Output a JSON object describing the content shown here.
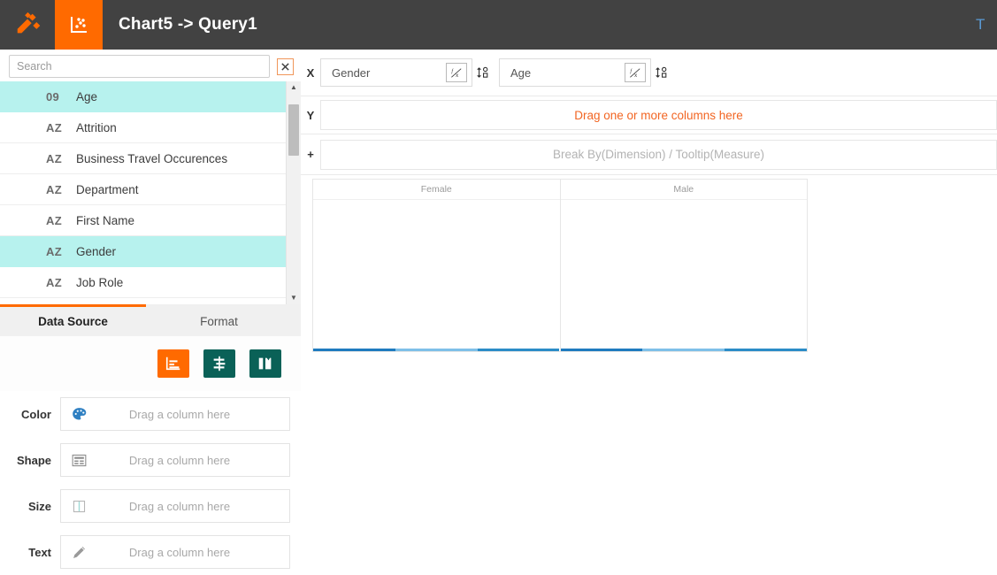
{
  "header": {
    "title": "Chart5 -> Query1",
    "logo_icon": "app-logo-icon",
    "chart_tab_icon": "scatter-chart-icon",
    "right_edge_label": "T"
  },
  "sidebar": {
    "search": {
      "placeholder": "Search",
      "value": "",
      "clear_label": "✕"
    },
    "columns": [
      {
        "type": "09",
        "name": "Age",
        "selected": true
      },
      {
        "type": "AZ",
        "name": "Attrition",
        "selected": false
      },
      {
        "type": "AZ",
        "name": "Business Travel Occurences",
        "selected": false
      },
      {
        "type": "AZ",
        "name": "Department",
        "selected": false
      },
      {
        "type": "AZ",
        "name": "First Name",
        "selected": false
      },
      {
        "type": "AZ",
        "name": "Gender",
        "selected": true
      },
      {
        "type": "AZ",
        "name": "Job Role",
        "selected": false
      }
    ],
    "scrollbar": {
      "up": "▲",
      "down": "▼"
    },
    "tabs": [
      {
        "label": "Data Source",
        "active": true
      },
      {
        "label": "Format",
        "active": false
      }
    ],
    "chart_type_buttons": [
      {
        "name": "bar-chart-type-button",
        "color": "#ff6a00",
        "active": true
      },
      {
        "name": "stacked-chart-type-button",
        "color": "#0a6157",
        "active": false
      },
      {
        "name": "rotate-chart-type-button",
        "color": "#0a6157",
        "active": false
      }
    ],
    "encodings": [
      {
        "label": "Color",
        "icon": "palette-icon",
        "placeholder": "Drag a column here"
      },
      {
        "label": "Shape",
        "icon": "shape-form-icon",
        "placeholder": "Drag a column here"
      },
      {
        "label": "Size",
        "icon": "size-bar-icon",
        "placeholder": "Drag a column here"
      },
      {
        "label": "Text",
        "icon": "pencil-icon",
        "placeholder": "Drag a column here"
      }
    ]
  },
  "shelves": {
    "x": {
      "key": "X",
      "pills": [
        {
          "text": "Gender",
          "fx_icon": "function-fx-icon",
          "sort_icon": "sort-az-icon"
        },
        {
          "text": "Age",
          "fx_icon": "function-fx-icon",
          "sort_icon": "sort-az-icon"
        }
      ]
    },
    "y": {
      "key": "Y",
      "placeholder": "Drag one or more columns here"
    },
    "plus": {
      "key": "+",
      "placeholder": "Break By(Dimension) / Tooltip(Measure)"
    }
  },
  "chart_data": {
    "type": "bar",
    "title": "",
    "xlabel": "",
    "ylabel": "",
    "facet_field": "Gender",
    "categories": [
      "Female",
      "Male"
    ],
    "series": [
      {
        "name": "Female",
        "values": [
          0,
          0,
          0
        ]
      },
      {
        "name": "Male",
        "values": [
          0,
          0,
          0
        ]
      }
    ],
    "bar_colors": [
      "#1f7bbf",
      "#7fc0e8",
      "#2b8cc7"
    ],
    "grid": false,
    "legend": "none"
  },
  "colors": {
    "accent_orange": "#ff6a00",
    "header_dark": "#424242",
    "select_cyan": "#b7f2ee",
    "teal": "#0a6157",
    "bar_blue": "#1f7bbf"
  }
}
